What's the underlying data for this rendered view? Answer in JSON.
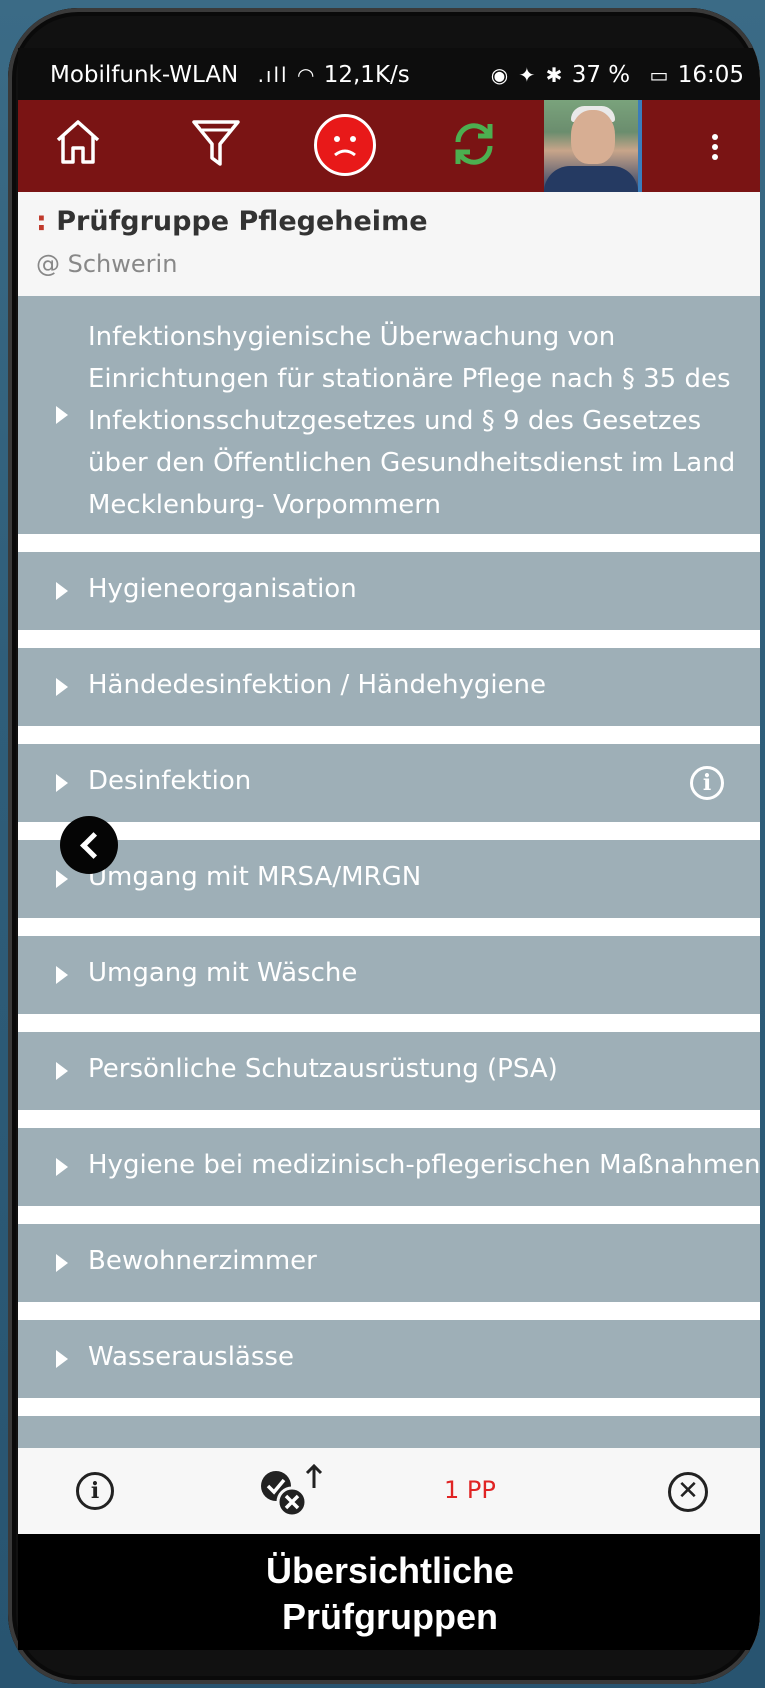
{
  "status_bar": {
    "carrier": "Mobilfunk-WLAN",
    "speed": "12,1K/s",
    "battery": "37 %",
    "time": "16:05"
  },
  "toolbar": {
    "icons": [
      "home-icon",
      "filter-icon",
      "sad-face-icon",
      "refresh-icon",
      "avatar",
      "more-vert-icon"
    ],
    "accent_color": "#7a1414",
    "sad_color": "#e81919",
    "refresh_color": "#4caf50"
  },
  "header": {
    "title_prefix": ":",
    "title": "Prüfgruppe Pflegeheime",
    "subtitle": "@ Schwerin"
  },
  "sections": [
    {
      "label": "Infektionshygienische Überwachung von Einrichtungen für stationäre Pflege nach § 35 des Infektionsschutzgesetzes und § 9 des Gesetzes über den Öffentlichen Gesundheitsdienst im Land Mecklenburg- Vorpommern"
    },
    {
      "label": "Hygieneorganisation"
    },
    {
      "label": "Händedesinfektion / Händehygiene"
    },
    {
      "label": "Desinfektion"
    },
    {
      "label": "Umgang mit MRSA/MRGN"
    },
    {
      "label": "Umgang mit Wäsche"
    },
    {
      "label": "Persönliche Schutzausrüstung (PSA)"
    },
    {
      "label": "Hygiene bei medizinisch-pflegerischen Maßnahmen"
    },
    {
      "label": "Bewohnerzimmer"
    },
    {
      "label": "Wasserauslässe"
    }
  ],
  "bottom_bar": {
    "pp_count": "1 PP",
    "pp_color": "#e02424"
  },
  "footer": {
    "line1": "Übersichtliche",
    "line2": "Prüfgruppen"
  }
}
